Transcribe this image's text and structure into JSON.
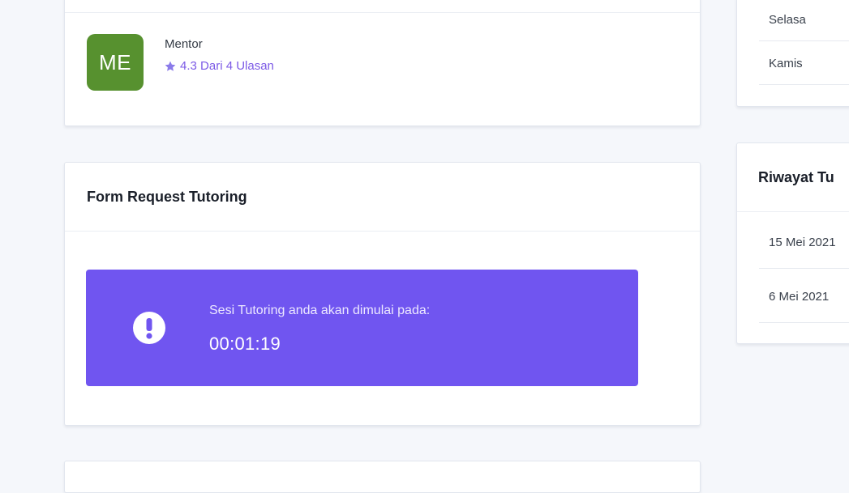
{
  "mentor": {
    "avatar_initials": "ME",
    "avatar_color": "#57912f",
    "role": "Mentor",
    "rating_text": "4.3 Dari 4 Ulasan",
    "rating_icon": "star-icon"
  },
  "form_request": {
    "title": "Form Request Tutoring",
    "alert": {
      "icon": "exclamation-circle-icon",
      "message": "Sesi Tutoring anda akan dimulai pada:",
      "countdown": "00:01:19",
      "background_color": "#7055f0"
    }
  },
  "schedule": {
    "days": [
      "Selasa",
      "Kamis"
    ]
  },
  "history": {
    "title": "Riwayat Tu",
    "dates": [
      "15 Mei 2021",
      "6 Mei 2021"
    ]
  },
  "colors": {
    "accent": "#7c5ae6",
    "page_background": "#f5f7fb"
  }
}
